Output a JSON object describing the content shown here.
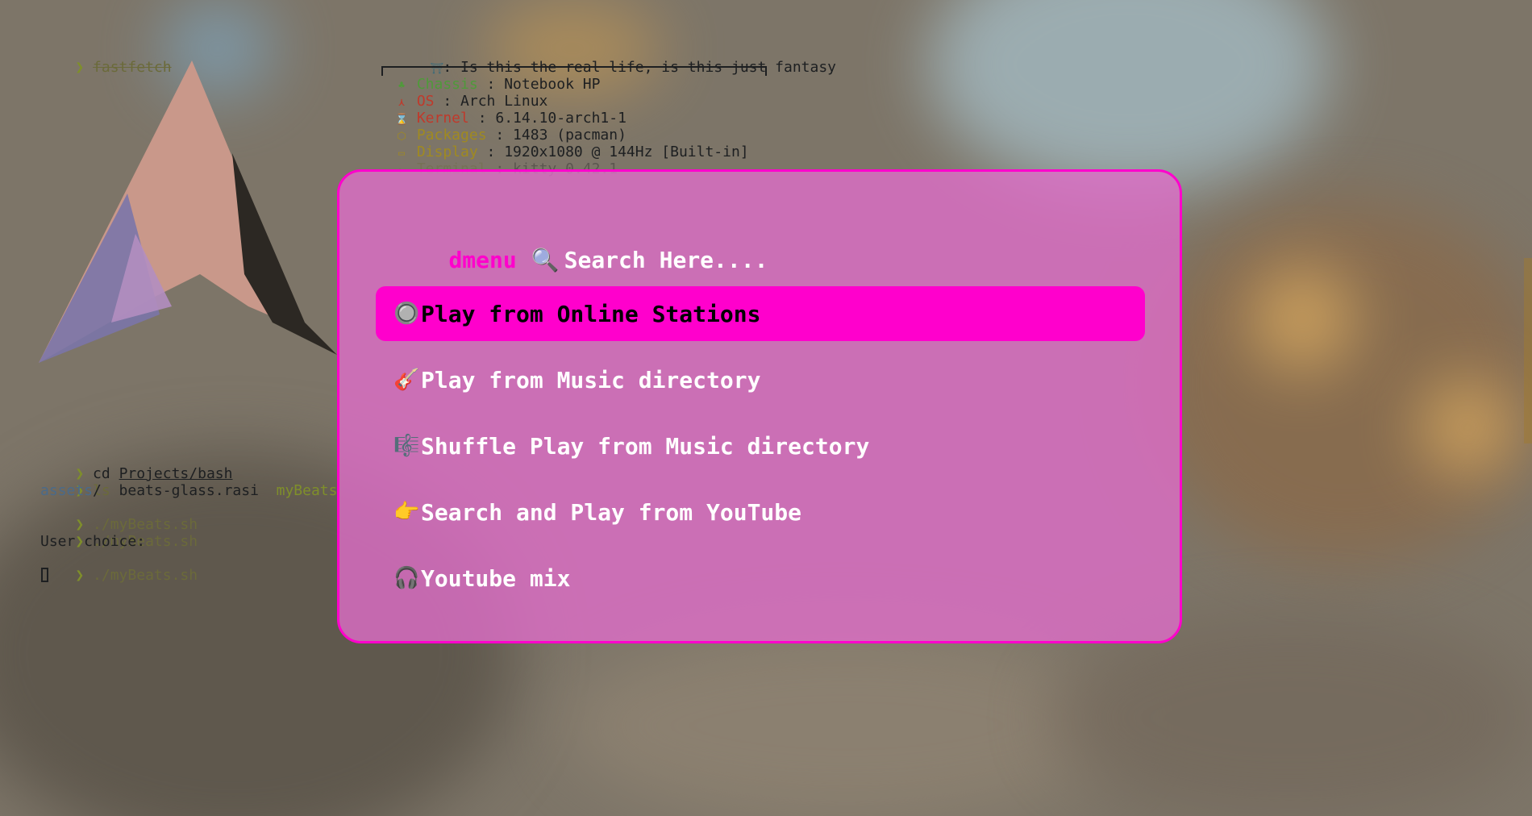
{
  "terminal": {
    "cmd1": "fastfetch",
    "title_line": ": Is this the real life, is this just fantasy",
    "info": [
      {
        "icon": "♣",
        "icon_color": "#4f9a3a",
        "key": "Chassis",
        "key_color": "#4f9a3a",
        "value": " : Notebook HP"
      },
      {
        "icon": "⋏",
        "icon_color": "#c0392b",
        "key": "OS",
        "key_color": "#c0392b",
        "value": " : Arch Linux"
      },
      {
        "icon": "⌛",
        "icon_color": "#c0392b",
        "key": "Kernel",
        "key_color": "#c0392b",
        "value": " : 6.14.10-arch1-1"
      },
      {
        "icon": "⬡",
        "icon_color": "#a08a20",
        "key": "Packages",
        "key_color": "#a08a20",
        "value": " : 1483 (pacman)"
      },
      {
        "icon": "▭",
        "icon_color": "#a08a20",
        "key": "Display",
        "key_color": "#a08a20",
        "value": " : 1920x1080 @ 144Hz [Built-in]"
      },
      {
        "icon": "▸",
        "icon_color": "#6b6a3a",
        "key": "Terminal",
        "key_color": "#6b6a3a",
        "value": " : kitty 0.42.1"
      }
    ],
    "history": {
      "cd_cmd": "cd",
      "cd_arg": "Projects/bash",
      "ls_cmd": "ls",
      "ls_dir": "assets",
      "ls_sep": "/  ",
      "ls_file": "beats-glass.rasi  ",
      "ls_exec": "myBeats",
      "run1": "./myBeats.sh",
      "run2": "./myBeats.sh",
      "output": "User choice:",
      "run3": "./myBeats.sh"
    },
    "prompt_symbol": "❯"
  },
  "menu": {
    "prompt": "dmenu",
    "search_icon": "🔍",
    "search_text": "Search Here....",
    "entries": [
      {
        "emoji": "🔘",
        "label": "Play from Online Stations"
      },
      {
        "emoji": "🎸",
        "label": "Play from Music directory"
      },
      {
        "emoji": "🎼",
        "label": "Shuffle Play from Music directory"
      },
      {
        "emoji": "👉",
        "label": "Search and Play from YouTube"
      },
      {
        "emoji": "🎧",
        "label": "Youtube mix"
      }
    ],
    "selected_index": 0,
    "accent_color": "#ff00cc"
  }
}
